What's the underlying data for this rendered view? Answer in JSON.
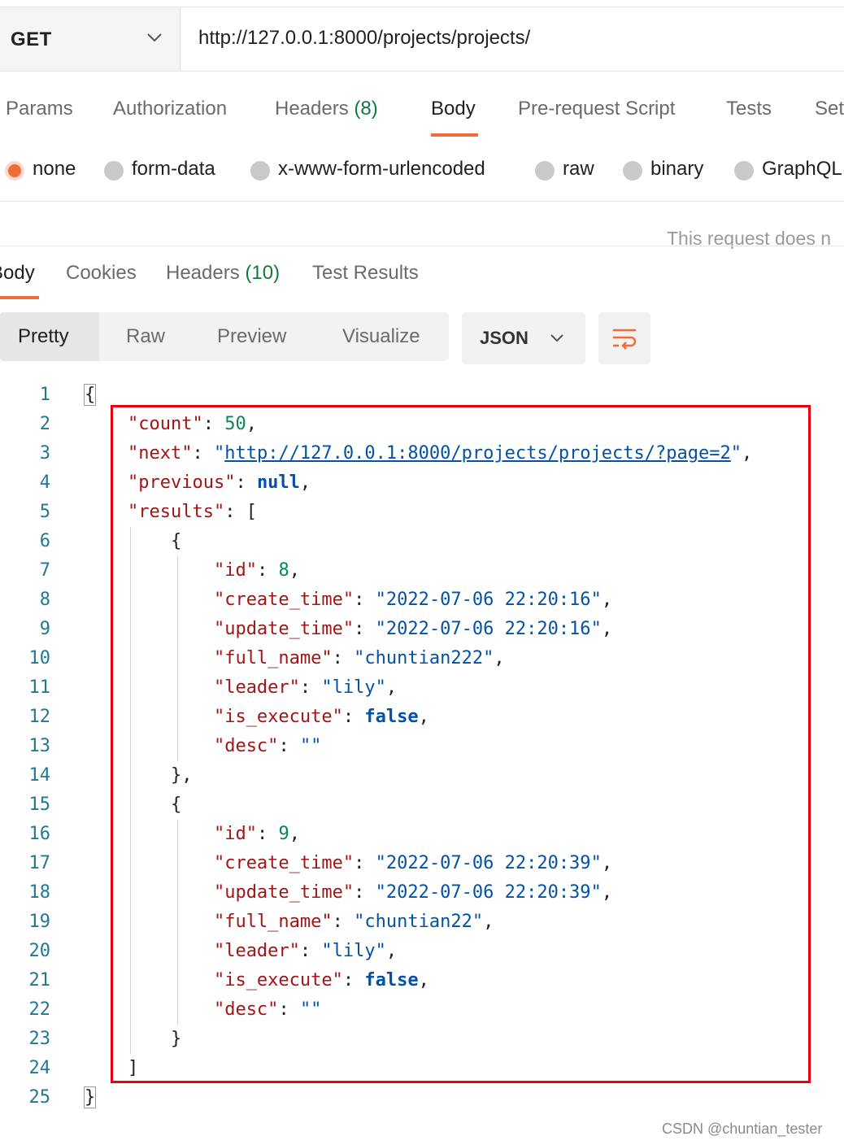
{
  "request": {
    "method": "GET",
    "url": "http://127.0.0.1:8000/projects/projects/"
  },
  "request_tabs": [
    {
      "label": "Params",
      "count": ""
    },
    {
      "label": "Authorization",
      "count": ""
    },
    {
      "label": "Headers",
      "count": "(8)"
    },
    {
      "label": "Body",
      "count": ""
    },
    {
      "label": "Pre-request Script",
      "count": ""
    },
    {
      "label": "Tests",
      "count": ""
    },
    {
      "label": "Set",
      "count": ""
    }
  ],
  "body_types": [
    "none",
    "form-data",
    "x-www-form-urlencoded",
    "raw",
    "binary",
    "GraphQL"
  ],
  "body_types_selected": "none",
  "request_note": "This request does n",
  "response_tabs": [
    {
      "label": "Body",
      "count": ""
    },
    {
      "label": "Cookies",
      "count": ""
    },
    {
      "label": "Headers",
      "count": "(10)"
    },
    {
      "label": "Test Results",
      "count": ""
    }
  ],
  "view_modes": [
    "Pretty",
    "Raw",
    "Preview",
    "Visualize"
  ],
  "view_mode_selected": "Pretty",
  "format": "JSON",
  "icons": {
    "method_dropdown": "chevron-down-icon",
    "format_dropdown": "chevron-down-icon",
    "wrap": "wrap-lines-icon"
  },
  "colors": {
    "accent": "#f26b3a",
    "count": "#0f7b3c",
    "highlight": "#e50012"
  },
  "line_numbers": [
    "1",
    "2",
    "3",
    "4",
    "5",
    "6",
    "7",
    "8",
    "9",
    "10",
    "11",
    "12",
    "13",
    "14",
    "15",
    "16",
    "17",
    "18",
    "19",
    "20",
    "21",
    "22",
    "23",
    "24",
    "25"
  ],
  "response_json": {
    "count": "50",
    "next": "http://127.0.0.1:8000/projects/projects/?page=2",
    "previous": "null",
    "results": [
      {
        "id": "8",
        "create_time": "2022-07-06 22:20:16",
        "update_time": "2022-07-06 22:20:16",
        "full_name": "chuntian222",
        "leader": "lily",
        "is_execute": "false",
        "desc": ""
      },
      {
        "id": "9",
        "create_time": "2022-07-06 22:20:39",
        "update_time": "2022-07-06 22:20:39",
        "full_name": "chuntian22",
        "leader": "lily",
        "is_execute": "false",
        "desc": ""
      }
    ]
  },
  "watermark": "CSDN @chuntian_tester"
}
